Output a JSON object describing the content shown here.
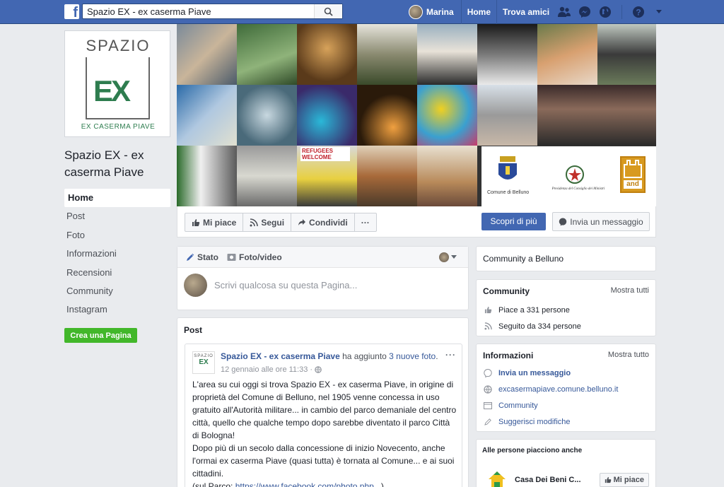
{
  "topbar": {
    "logo": "f",
    "search_value": "Spazio EX - ex caserma Piave",
    "user_name": "Marina",
    "home": "Home",
    "find_friends": "Trova amici",
    "brand_color": "#4267b2"
  },
  "profile": {
    "logo_word": "SPAZIO",
    "logo_mark": "EX",
    "logo_sub": "EX CASERMA PIAVE",
    "page_name": "Spazio EX - ex caserma Piave"
  },
  "leftnav": {
    "items": [
      "Home",
      "Post",
      "Foto",
      "Informazioni",
      "Recensioni",
      "Community",
      "Instagram"
    ],
    "create_page": "Crea una Pagina"
  },
  "cover": {
    "sign_text": "REFUGEES WELCOME",
    "logo_captions": [
      "Comune di Belluno",
      "Presidenza del Consiglio dei Ministri",
      "and"
    ]
  },
  "actions": {
    "like": "Mi piace",
    "follow": "Segui",
    "share": "Condividi",
    "more": "···",
    "learn_more": "Scopri di più",
    "send_message": "Invia un messaggio"
  },
  "composer": {
    "tab_status": "Stato",
    "tab_photo": "Foto/video",
    "placeholder": "Scrivi qualcosa su questa Pagina..."
  },
  "posts": {
    "header": "Post",
    "items": [
      {
        "author": "Spazio EX - ex caserma Piave",
        "action_prefix": " ha aggiunto ",
        "action_link": "3 nuove foto",
        "action_suffix": ".",
        "time": "12 gennaio alle ore 11:33 · ",
        "p1": "L'area su cui oggi si trova Spazio EX - ex caserma Piave, in origine di proprietà del Comune di Belluno, nel 1905 venne concessa in uso gratuito all'Autorità militare... in cambio del parco demaniale del centro città, quello che qualche tempo dopo sarebbe diventato il parco Città di Bologna!",
        "p2": "Dopo più di un secolo dalla concessione di inizio Novecento, anche l'ormai ex caserma Piave (quasi tutta) è tornata al Comune... e ai suoi cittadini.",
        "p3_prefix": "(sul Parco: ",
        "p3_link": "https://www.facebook.com/photo.php...",
        "p3_suffix": ")"
      }
    ]
  },
  "right": {
    "community_belluno": "Community a Belluno",
    "community": {
      "title": "Community",
      "see_all": "Mostra tutti",
      "likes": "Piace a 331 persone",
      "follows": "Seguito da 334 persone"
    },
    "info": {
      "title": "Informazioni",
      "see_all": "Mostra tutto",
      "send_message": "Invia un messaggio",
      "website": "excasermapiave.comune.belluno.it",
      "category": "Community",
      "suggest": "Suggerisci modifiche"
    },
    "also_liked": {
      "title": "Alle persone piacciono anche",
      "item_name": "Casa Dei Beni C...",
      "item_btn": "Mi piace"
    }
  }
}
